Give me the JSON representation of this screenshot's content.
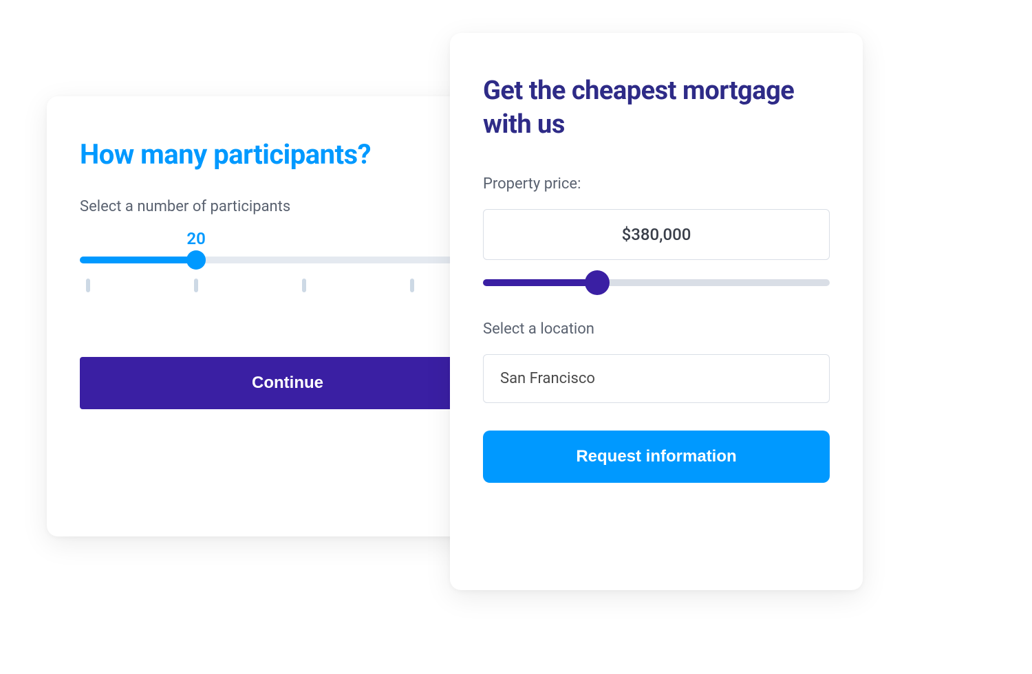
{
  "participants_card": {
    "heading": "How many participants?",
    "subheading": "Select a number of participants",
    "slider_value": "20",
    "button_label": "Continue"
  },
  "mortgage_card": {
    "heading": "Get the cheapest mortgage with us",
    "price_label": "Property price:",
    "price_value": "$380,000",
    "location_label": "Select a location",
    "location_value": "San Francisco",
    "button_label": "Request information"
  },
  "colors": {
    "blue": "#0099ff",
    "indigo": "#3a1fa3",
    "heading_indigo": "#2e2b87",
    "muted": "#5a6270"
  }
}
